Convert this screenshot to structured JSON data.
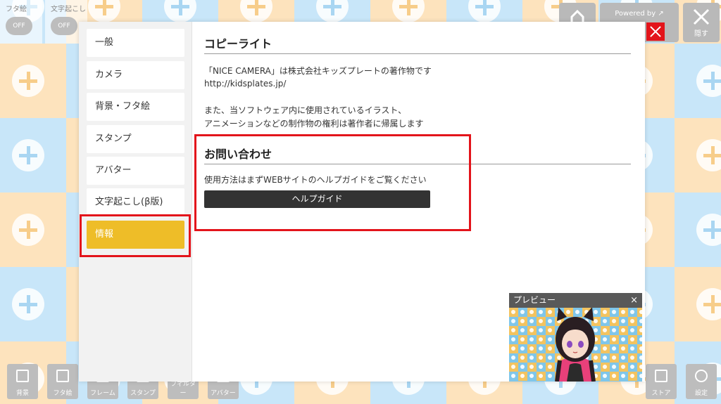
{
  "app": {
    "toggles": [
      {
        "label": "フタ絵",
        "state": "OFF"
      },
      {
        "label": "文字起こし",
        "state": "OFF"
      }
    ],
    "top_right": {
      "home_label": "",
      "powered_by": "Powered by ↗",
      "hide_label": "隠す"
    },
    "bottom_toolbar": [
      {
        "label": "背景",
        "icon": "image-icon"
      },
      {
        "label": "フタ絵",
        "icon": "frame-icon"
      },
      {
        "label": "フレーム",
        "icon": "frame-border-icon"
      },
      {
        "label": "スタンプ",
        "icon": "stamp-icon"
      },
      {
        "label": "フィルター",
        "icon": "filter-icon"
      },
      {
        "label": "アバター",
        "icon": "avatar-icon"
      }
    ],
    "bottom_right": [
      {
        "label": "ストア",
        "icon": "store-icon"
      },
      {
        "label": "設定",
        "icon": "gear-icon"
      }
    ],
    "colors": {
      "accent": "#eebd28",
      "annotation": "#e3141b",
      "tile_blue": "#c8e6f9",
      "tile_orange": "#fde3bd"
    }
  },
  "settings": {
    "menu": [
      "一般",
      "カメラ",
      "背景・フタ絵",
      "スタンプ",
      "アバター",
      "文字起こし(β版)",
      "情報"
    ],
    "active_index": 6,
    "copyright": {
      "title": "コピーライト",
      "line1": "「NICE CAMERA」は株式会社キッズプレートの著作物です",
      "line2": "http://kidsplates.jp/",
      "line3": "また、当ソフトウェア内に使用されているイラスト、",
      "line4": "アニメーションなどの制作物の権利は著作者に帰属します"
    },
    "contact": {
      "title": "お問い合わせ",
      "text": "使用方法はまずWEBサイトのヘルプガイドをご覧ください",
      "button": "ヘルプガイド"
    }
  },
  "preview": {
    "title": "プレビュー",
    "close": "×"
  }
}
